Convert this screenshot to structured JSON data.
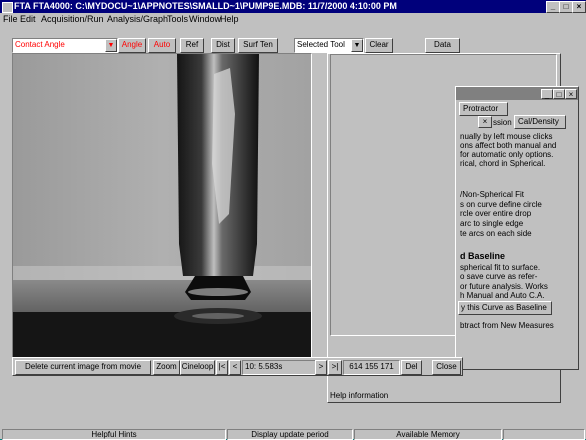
{
  "window": {
    "title": "FTA FTA4000: C:\\MYDOCU~1\\APPNOTES\\SMALLD~1\\PUMP9E.MDB: 11/7/2000 4:10:00 PM",
    "controls": [
      "_",
      "□",
      "×"
    ]
  },
  "menu": [
    "File",
    "Edit",
    "Acquisition/Run",
    "Analysis/Graph",
    "Tools",
    "Window",
    "Help"
  ],
  "toolbar": {
    "measurement": "Contact Angle",
    "angle": "Angle",
    "auto": "Auto",
    "ref": "Ref",
    "dist": "Dist",
    "surf_ten": "Surf Ten",
    "tool": "Selected Tool",
    "clear": "Clear",
    "data": "Data"
  },
  "protractor": {
    "tab": "Protractor",
    "tabs": [
      "ssion",
      "Cal/Density"
    ],
    "lines_a": [
      "nually by left mouse clicks",
      "ons affect both manual and",
      "for automatic only options.",
      "rical, chord in Spherical."
    ],
    "lines_b": [
      "/Non-Spherical Fit",
      "s on curve define circle",
      "rcle over entire drop",
      "arc to single edge",
      "te arcs on each side"
    ],
    "baseline_title": "d Baseline",
    "lines_c": [
      "spherical fit to surface.",
      "o save curve as refer-",
      "or future analysis.  Works",
      "h Manual and Auto C.A."
    ],
    "baseline_button": "y this Curve as Baseline",
    "subtract": "btract from New Measures"
  },
  "help_info": "Help information",
  "movie": {
    "delete": "Delete current image from movie",
    "zoom": "Zoom",
    "cineloop": "Cineloop",
    "first": "|<",
    "prev": "<",
    "frame": "10: 5.583s",
    "next": ">",
    "last": ">|",
    "stats": "614  155  171",
    "del": "Del",
    "close": "Close"
  },
  "status": {
    "hints": "Helpful Hints",
    "update": "Display update period",
    "memory": "Available Memory"
  },
  "colors": {
    "title": "#00007b",
    "face": "#c0c0c0",
    "red_text": "#ff0000"
  }
}
